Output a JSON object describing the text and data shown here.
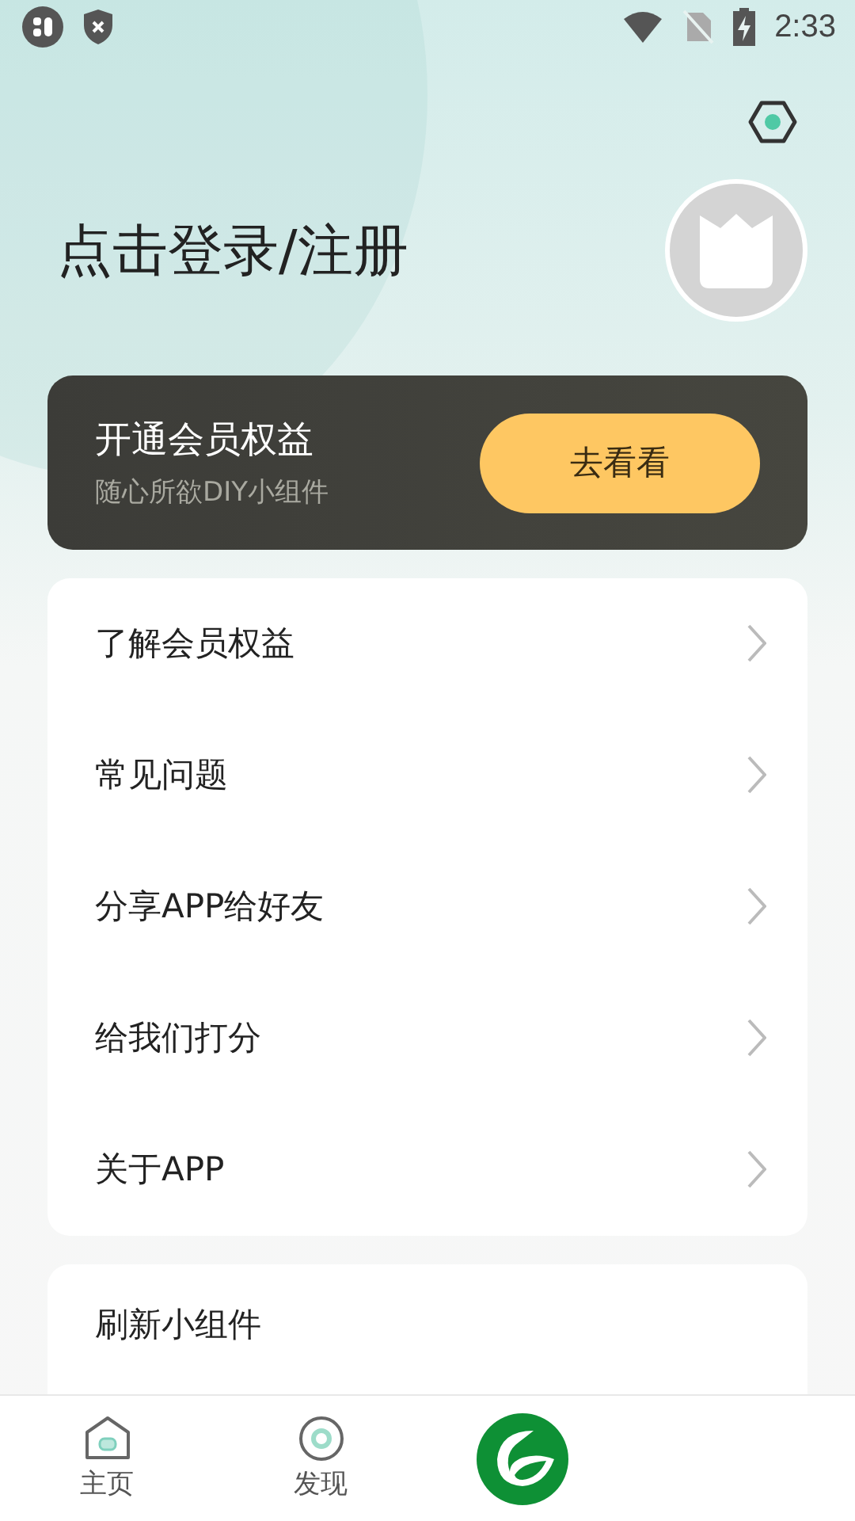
{
  "status_bar": {
    "time": "2:33"
  },
  "login": {
    "title": "点击登录/注册"
  },
  "vip_card": {
    "title": "开通会员权益",
    "subtitle": "随心所欲DIY小组件",
    "button": "去看看"
  },
  "menu": [
    {
      "label": "了解会员权益"
    },
    {
      "label": "常见问题"
    },
    {
      "label": "分享APP给好友"
    },
    {
      "label": "给我们打分"
    },
    {
      "label": "关于APP"
    }
  ],
  "second_card": {
    "title": "刷新小组件"
  },
  "bottom_nav": [
    {
      "label": "主页",
      "kind": "home"
    },
    {
      "label": "发现",
      "kind": "discover"
    },
    {
      "kind": "logo"
    }
  ]
}
